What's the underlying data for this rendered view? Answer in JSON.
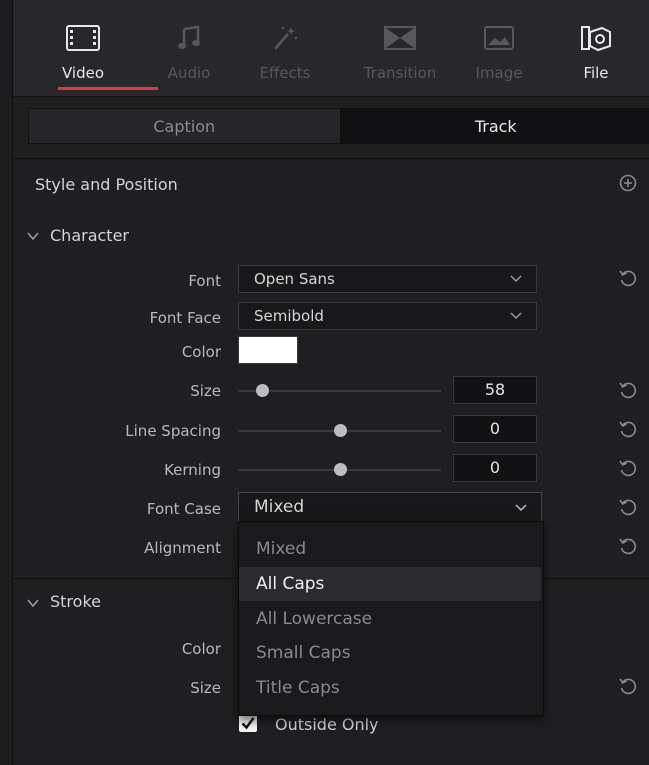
{
  "tabs": [
    {
      "label": "Video",
      "icon": "film-icon",
      "state": "active"
    },
    {
      "label": "Audio",
      "icon": "music-note-icon",
      "state": "off"
    },
    {
      "label": "Effects",
      "icon": "magic-wand-icon",
      "state": "off"
    },
    {
      "label": "Transition",
      "icon": "transition-icon",
      "state": "off"
    },
    {
      "label": "Image",
      "icon": "image-icon",
      "state": "off"
    },
    {
      "label": "File",
      "icon": "file-icon",
      "state": "on"
    }
  ],
  "segment": {
    "caption": "Caption",
    "track": "Track"
  },
  "style_position": {
    "title": "Style and Position"
  },
  "character": {
    "title": "Character",
    "font_label": "Font",
    "font_value": "Open Sans",
    "face_label": "Font Face",
    "face_value": "Semibold",
    "color_label": "Color",
    "size_label": "Size",
    "size_value": "58",
    "size_level": 0.12,
    "spacing_label": "Line Spacing",
    "spacing_value": "0",
    "spacing_level": 0.5,
    "kerning_label": "Kerning",
    "kerning_value": "0",
    "kerning_level": 0.5,
    "case_label": "Font Case",
    "case_value": "Mixed",
    "align_label": "Alignment"
  },
  "menu": {
    "items": [
      "Mixed",
      "All Caps",
      "All Lowercase",
      "Small Caps",
      "Title Caps"
    ],
    "highlighted": 1
  },
  "stroke": {
    "title": "Stroke",
    "color_label": "Color",
    "size_label": "Size",
    "outside_label": "Outside Only"
  },
  "colors": {
    "accent": "#e03b3b",
    "text_color": "#ffffff"
  }
}
